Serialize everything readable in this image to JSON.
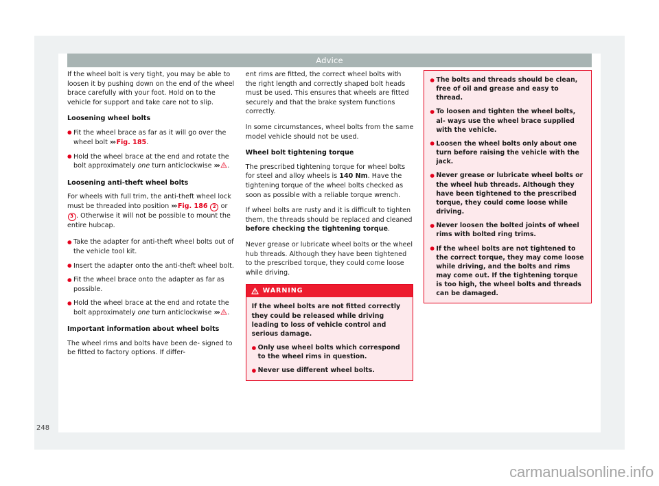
{
  "header": {
    "title": "Advice"
  },
  "page_number": "248",
  "watermark": "carmanualsonline.info",
  "icons": {
    "warning_triangle": "warning-triangle-icon",
    "chevron_ref": "triple-chevron-icon"
  },
  "colors": {
    "header_bar": "#a8b4b3",
    "accent_red": "#e3001b",
    "warning_header": "#ed1b2e",
    "warning_bg": "#fde9ec",
    "page_bg": "#ffffff",
    "viewer_bg": "#eef1f2"
  },
  "left_column": {
    "intro_para": "If the wheel bolt is very tight, you may be able to loosen it by pushing down on the end of the wheel brace carefully with your foot. Hold on to the vehicle for support and take care not to slip.",
    "heading_loosening": "Loosening wheel bolts",
    "bullet1_pre": "Fit the wheel brace as far as it will go over the wheel bolt ",
    "bullet1_ref": "Fig. 185",
    "bullet1_post": ".",
    "bullet2_pre": "Hold the wheel brace at the end and rotate the bolt approximately ",
    "bullet2_em": "one",
    "bullet2_post": " turn anticlockwise",
    "bullet2_tail": ".",
    "heading_antitheft": "Loosening anti-theft wheel bolts",
    "antitheft_pre": "For wheels with full trim, the anti-theft wheel lock must be threaded into position ",
    "antitheft_ref": "Fig. 186",
    "antitheft_num1": "2",
    "antitheft_or": " or ",
    "antitheft_num2": "3",
    "antitheft_post": ". Otherwise it will not be possible to mount the entire hubcap.",
    "bullet3": "Take the adapter for anti-theft wheel bolts out of the vehicle tool kit.",
    "bullet4": "Insert the adapter onto the anti-theft wheel bolt.",
    "bullet5": "Fit the wheel brace onto the adapter as far as possible.",
    "bullet6_pre": "Hold the wheel brace at the end and rotate the bolt approximately ",
    "bullet6_em": "one",
    "bullet6_post": " turn anticlockwise",
    "bullet6_tail": ".",
    "heading_important": "Important information about wheel bolts",
    "important_para": "The wheel rims and bolts have been de- signed to be fitted to factory options. If differ-"
  },
  "middle_column": {
    "cont_para": "ent rims are fitted, the correct wheel bolts with the right length and correctly shaped bolt heads must be used. This ensures that wheels are fitted securely and that the brake system functions correctly.",
    "para2": "In some circumstances, wheel bolts from the same model vehicle should not be used.",
    "heading_torque": "Wheel bolt tightening torque",
    "torque_pre": "The prescribed tightening torque for wheel bolts for steel and alloy wheels is ",
    "torque_value": "140 Nm",
    "torque_post": ". Have the tightening torque of the wheel bolts checked as soon as possible with a reliable torque wrench.",
    "rusty_pre": "If wheel bolts are rusty and it is difficult to tighten them, the threads should be replaced and cleaned ",
    "rusty_bold": "before checking the tightening torque",
    "rusty_post": ".",
    "grease_para": "Never grease or lubricate wheel bolts or the wheel hub threads. Although they have been tightened to the prescribed torque, they could come loose while driving.",
    "warning": {
      "label": "WARNING",
      "intro": "If the wheel bolts are not fitted correctly they could be released while driving leading to loss of vehicle control and serious damage.",
      "bullets": [
        "Only use wheel bolts which correspond to the wheel rims in question.",
        "Never use different wheel bolts."
      ]
    }
  },
  "right_column": {
    "warning_continued_bullets": [
      "The bolts and threads should be clean, free of oil and grease and easy to thread.",
      "To loosen and tighten the wheel bolts, al- ways use the wheel brace supplied with the vehicle.",
      "Loosen the wheel bolts only about one turn before raising the vehicle with the jack.",
      "Never grease or lubricate wheel bolts or the wheel hub threads. Although they have been tightened to the prescribed torque, they could come loose while driving.",
      "Never loosen the bolted joints of wheel rims with bolted ring trims.",
      "If the wheel bolts are not tightened to the correct torque, they may come loose while driving, and the bolts and rims may come out. If the tightening torque is too high, the wheel bolts and threads can be damaged."
    ]
  }
}
